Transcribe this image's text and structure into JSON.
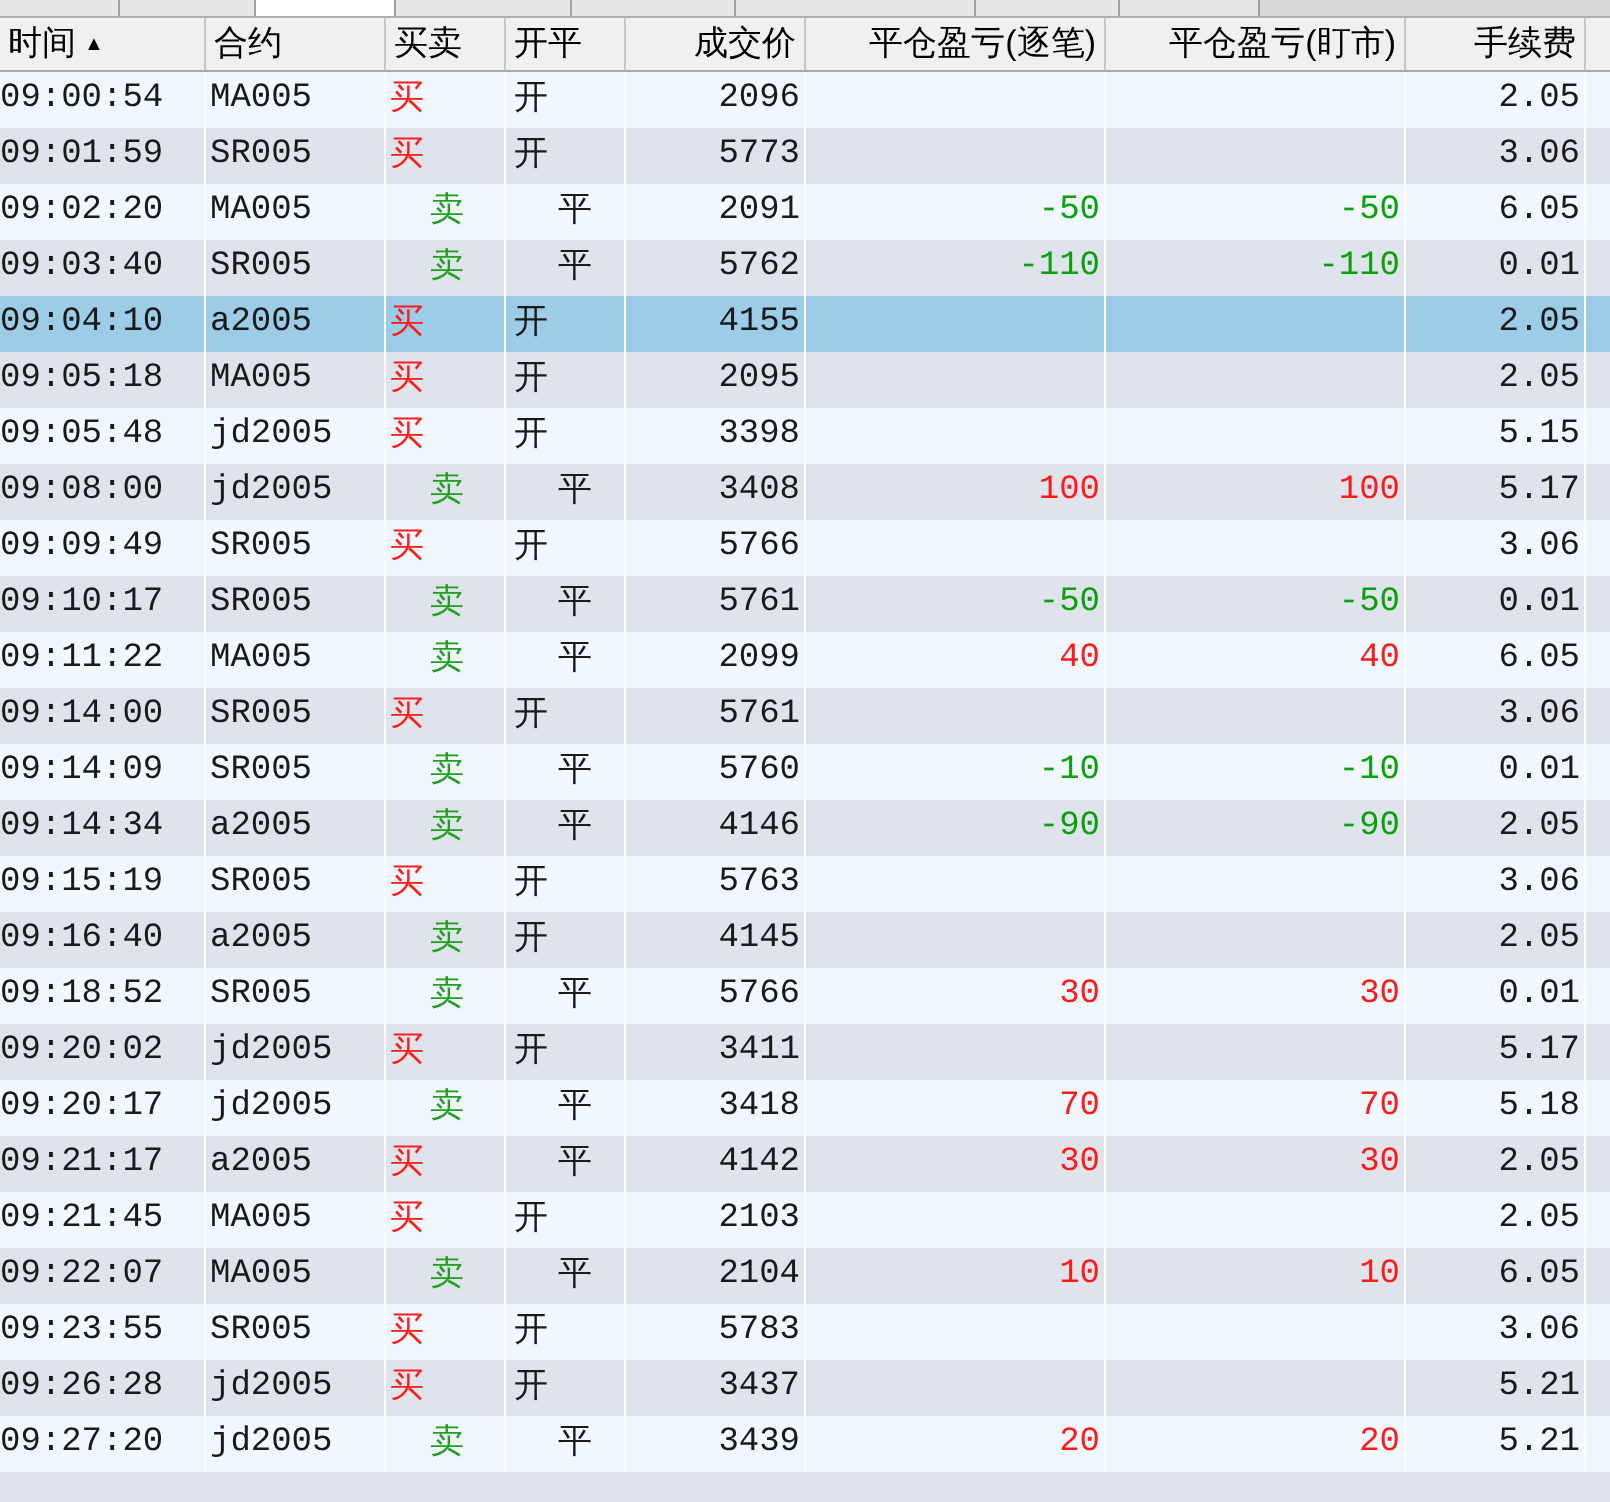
{
  "tabs": [
    {
      "selected": false
    },
    {
      "selected": false
    },
    {
      "selected": true
    },
    {
      "selected": false
    },
    {
      "selected": false
    },
    {
      "selected": false
    },
    {
      "selected": false
    },
    {
      "selected": false
    }
  ],
  "table": {
    "columns": [
      "时间",
      "合约",
      "买卖",
      "开平",
      "成交价",
      "平仓盈亏(逐笔)",
      "平仓盈亏(盯市)",
      "手续费"
    ],
    "sort_mark": "▲",
    "rows": [
      {
        "time": "09:00:54",
        "contract": "MA005",
        "side": {
          "text": "买",
          "kind": "buy"
        },
        "offset": {
          "text": "开",
          "kind": "open"
        },
        "price": "2096",
        "fee": "2.05",
        "selected": false
      },
      {
        "time": "09:01:59",
        "contract": "SR005",
        "side": {
          "text": "买",
          "kind": "buy"
        },
        "offset": {
          "text": "开",
          "kind": "open"
        },
        "price": "5773",
        "fee": "3.06",
        "selected": false
      },
      {
        "time": "09:02:20",
        "contract": "MA005",
        "side": {
          "text": "卖",
          "kind": "sell"
        },
        "offset": {
          "text": "平",
          "kind": "close"
        },
        "price": "2091",
        "pnl_trade": {
          "text": "-50",
          "kind": "loss"
        },
        "pnl_mark": {
          "text": "-50",
          "kind": "loss"
        },
        "fee": "6.05",
        "selected": false
      },
      {
        "time": "09:03:40",
        "contract": "SR005",
        "side": {
          "text": "卖",
          "kind": "sell"
        },
        "offset": {
          "text": "平",
          "kind": "close"
        },
        "price": "5762",
        "pnl_trade": {
          "text": "-110",
          "kind": "loss"
        },
        "pnl_mark": {
          "text": "-110",
          "kind": "loss"
        },
        "fee": "0.01",
        "selected": false
      },
      {
        "time": "09:04:10",
        "contract": "a2005",
        "side": {
          "text": "买",
          "kind": "buy"
        },
        "offset": {
          "text": "开",
          "kind": "open"
        },
        "price": "4155",
        "fee": "2.05",
        "selected": true
      },
      {
        "time": "09:05:18",
        "contract": "MA005",
        "side": {
          "text": "买",
          "kind": "buy"
        },
        "offset": {
          "text": "开",
          "kind": "open"
        },
        "price": "2095",
        "fee": "2.05",
        "selected": false
      },
      {
        "time": "09:05:48",
        "contract": "jd2005",
        "side": {
          "text": "买",
          "kind": "buy"
        },
        "offset": {
          "text": "开",
          "kind": "open"
        },
        "price": "3398",
        "fee": "5.15",
        "selected": false
      },
      {
        "time": "09:08:00",
        "contract": "jd2005",
        "side": {
          "text": "卖",
          "kind": "sell"
        },
        "offset": {
          "text": "平",
          "kind": "close"
        },
        "price": "3408",
        "pnl_trade": {
          "text": "100",
          "kind": "gain"
        },
        "pnl_mark": {
          "text": "100",
          "kind": "gain"
        },
        "fee": "5.17",
        "selected": false
      },
      {
        "time": "09:09:49",
        "contract": "SR005",
        "side": {
          "text": "买",
          "kind": "buy"
        },
        "offset": {
          "text": "开",
          "kind": "open"
        },
        "price": "5766",
        "fee": "3.06",
        "selected": false
      },
      {
        "time": "09:10:17",
        "contract": "SR005",
        "side": {
          "text": "卖",
          "kind": "sell"
        },
        "offset": {
          "text": "平",
          "kind": "close"
        },
        "price": "5761",
        "pnl_trade": {
          "text": "-50",
          "kind": "loss"
        },
        "pnl_mark": {
          "text": "-50",
          "kind": "loss"
        },
        "fee": "0.01",
        "selected": false
      },
      {
        "time": "09:11:22",
        "contract": "MA005",
        "side": {
          "text": "卖",
          "kind": "sell"
        },
        "offset": {
          "text": "平",
          "kind": "close"
        },
        "price": "2099",
        "pnl_trade": {
          "text": "40",
          "kind": "gain"
        },
        "pnl_mark": {
          "text": "40",
          "kind": "gain"
        },
        "fee": "6.05",
        "selected": false
      },
      {
        "time": "09:14:00",
        "contract": "SR005",
        "side": {
          "text": "买",
          "kind": "buy"
        },
        "offset": {
          "text": "开",
          "kind": "open"
        },
        "price": "5761",
        "fee": "3.06",
        "selected": false
      },
      {
        "time": "09:14:09",
        "contract": "SR005",
        "side": {
          "text": "卖",
          "kind": "sell"
        },
        "offset": {
          "text": "平",
          "kind": "close"
        },
        "price": "5760",
        "pnl_trade": {
          "text": "-10",
          "kind": "loss"
        },
        "pnl_mark": {
          "text": "-10",
          "kind": "loss"
        },
        "fee": "0.01",
        "selected": false
      },
      {
        "time": "09:14:34",
        "contract": "a2005",
        "side": {
          "text": "卖",
          "kind": "sell"
        },
        "offset": {
          "text": "平",
          "kind": "close"
        },
        "price": "4146",
        "pnl_trade": {
          "text": "-90",
          "kind": "loss"
        },
        "pnl_mark": {
          "text": "-90",
          "kind": "loss"
        },
        "fee": "2.05",
        "selected": false
      },
      {
        "time": "09:15:19",
        "contract": "SR005",
        "side": {
          "text": "买",
          "kind": "buy"
        },
        "offset": {
          "text": "开",
          "kind": "open"
        },
        "price": "5763",
        "fee": "3.06",
        "selected": false
      },
      {
        "time": "09:16:40",
        "contract": "a2005",
        "side": {
          "text": "卖",
          "kind": "sell"
        },
        "offset": {
          "text": "开",
          "kind": "open"
        },
        "price": "4145",
        "fee": "2.05",
        "selected": false
      },
      {
        "time": "09:18:52",
        "contract": "SR005",
        "side": {
          "text": "卖",
          "kind": "sell"
        },
        "offset": {
          "text": "平",
          "kind": "close"
        },
        "price": "5766",
        "pnl_trade": {
          "text": "30",
          "kind": "gain"
        },
        "pnl_mark": {
          "text": "30",
          "kind": "gain"
        },
        "fee": "0.01",
        "selected": false
      },
      {
        "time": "09:20:02",
        "contract": "jd2005",
        "side": {
          "text": "买",
          "kind": "buy"
        },
        "offset": {
          "text": "开",
          "kind": "open"
        },
        "price": "3411",
        "fee": "5.17",
        "selected": false
      },
      {
        "time": "09:20:17",
        "contract": "jd2005",
        "side": {
          "text": "卖",
          "kind": "sell"
        },
        "offset": {
          "text": "平",
          "kind": "close"
        },
        "price": "3418",
        "pnl_trade": {
          "text": "70",
          "kind": "gain"
        },
        "pnl_mark": {
          "text": "70",
          "kind": "gain"
        },
        "fee": "5.18",
        "selected": false
      },
      {
        "time": "09:21:17",
        "contract": "a2005",
        "side": {
          "text": "买",
          "kind": "buy"
        },
        "offset": {
          "text": "平",
          "kind": "close"
        },
        "price": "4142",
        "pnl_trade": {
          "text": "30",
          "kind": "gain"
        },
        "pnl_mark": {
          "text": "30",
          "kind": "gain"
        },
        "fee": "2.05",
        "selected": false
      },
      {
        "time": "09:21:45",
        "contract": "MA005",
        "side": {
          "text": "买",
          "kind": "buy"
        },
        "offset": {
          "text": "开",
          "kind": "open"
        },
        "price": "2103",
        "fee": "2.05",
        "selected": false
      },
      {
        "time": "09:22:07",
        "contract": "MA005",
        "side": {
          "text": "卖",
          "kind": "sell"
        },
        "offset": {
          "text": "平",
          "kind": "close"
        },
        "price": "2104",
        "pnl_trade": {
          "text": "10",
          "kind": "gain"
        },
        "pnl_mark": {
          "text": "10",
          "kind": "gain"
        },
        "fee": "6.05",
        "selected": false
      },
      {
        "time": "09:23:55",
        "contract": "SR005",
        "side": {
          "text": "买",
          "kind": "buy"
        },
        "offset": {
          "text": "开",
          "kind": "open"
        },
        "price": "5783",
        "fee": "3.06",
        "selected": false
      },
      {
        "time": "09:26:28",
        "contract": "jd2005",
        "side": {
          "text": "买",
          "kind": "buy"
        },
        "offset": {
          "text": "开",
          "kind": "open"
        },
        "price": "3437",
        "fee": "5.21",
        "selected": false
      },
      {
        "time": "09:27:20",
        "contract": "jd2005",
        "side": {
          "text": "卖",
          "kind": "sell"
        },
        "offset": {
          "text": "平",
          "kind": "close"
        },
        "price": "3439",
        "pnl_trade": {
          "text": "20",
          "kind": "gain"
        },
        "pnl_mark": {
          "text": "20",
          "kind": "gain"
        },
        "fee": "5.21",
        "selected": false
      }
    ]
  }
}
